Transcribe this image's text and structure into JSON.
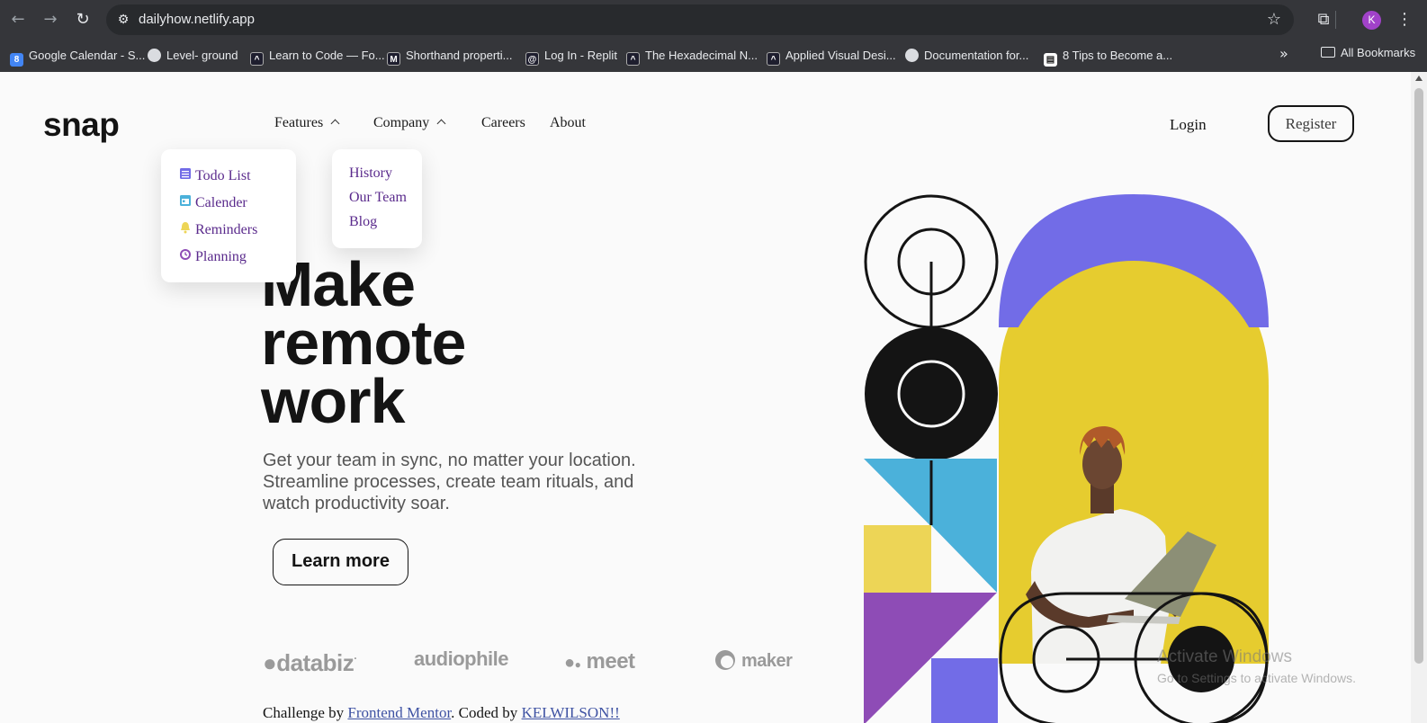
{
  "browser": {
    "url": "dailyhow.netlify.app",
    "avatar_letter": "K",
    "bookmarks": [
      "Google Calendar - S...",
      "Level- ground",
      "Learn to Code — Fo...",
      "Shorthand properti...",
      "Log In - Replit",
      "The Hexadecimal N...",
      "Applied Visual Desi...",
      "Documentation for...",
      "8 Tips to Become a..."
    ],
    "all_bookmarks": "All Bookmarks"
  },
  "site": {
    "logo": "snap",
    "nav": {
      "features": "Features",
      "company": "Company",
      "careers": "Careers",
      "about": "About"
    },
    "login": "Login",
    "register": "Register",
    "features_menu": [
      {
        "label": "Todo List",
        "icon": "calendar-list-icon",
        "color": "#726ce7"
      },
      {
        "label": "Calender",
        "icon": "calendar-icon",
        "color": "#4bb1da"
      },
      {
        "label": "Reminders",
        "icon": "bell-icon",
        "color": "#edd556"
      },
      {
        "label": "Planning",
        "icon": "clock-icon",
        "color": "#8e4cb6"
      }
    ],
    "company_menu": [
      "History",
      "Our Team",
      "Blog"
    ],
    "hero": {
      "line1": "Make",
      "line2": "remote",
      "line3": "work",
      "subtitle": "Get your team in sync, no matter your location. Streamline processes, create team rituals, and watch productivity soar.",
      "cta": "Learn more"
    },
    "clients": [
      "databiz",
      "audiophile",
      "meet",
      "maker"
    ],
    "footer": {
      "prefix": "Challenge by ",
      "link1": "Frontend Mentor",
      "middle": ". Coded by ",
      "link2": "KELWILSON!!"
    }
  },
  "watermark": {
    "line1": "Activate Windows",
    "line2": "Go to Settings to activate Windows."
  },
  "colors": {
    "purple_blue": "#726ce7",
    "yellow": "#edd556",
    "cyan": "#4bb1da",
    "violet": "#8e4cb6",
    "ink": "#141414"
  }
}
